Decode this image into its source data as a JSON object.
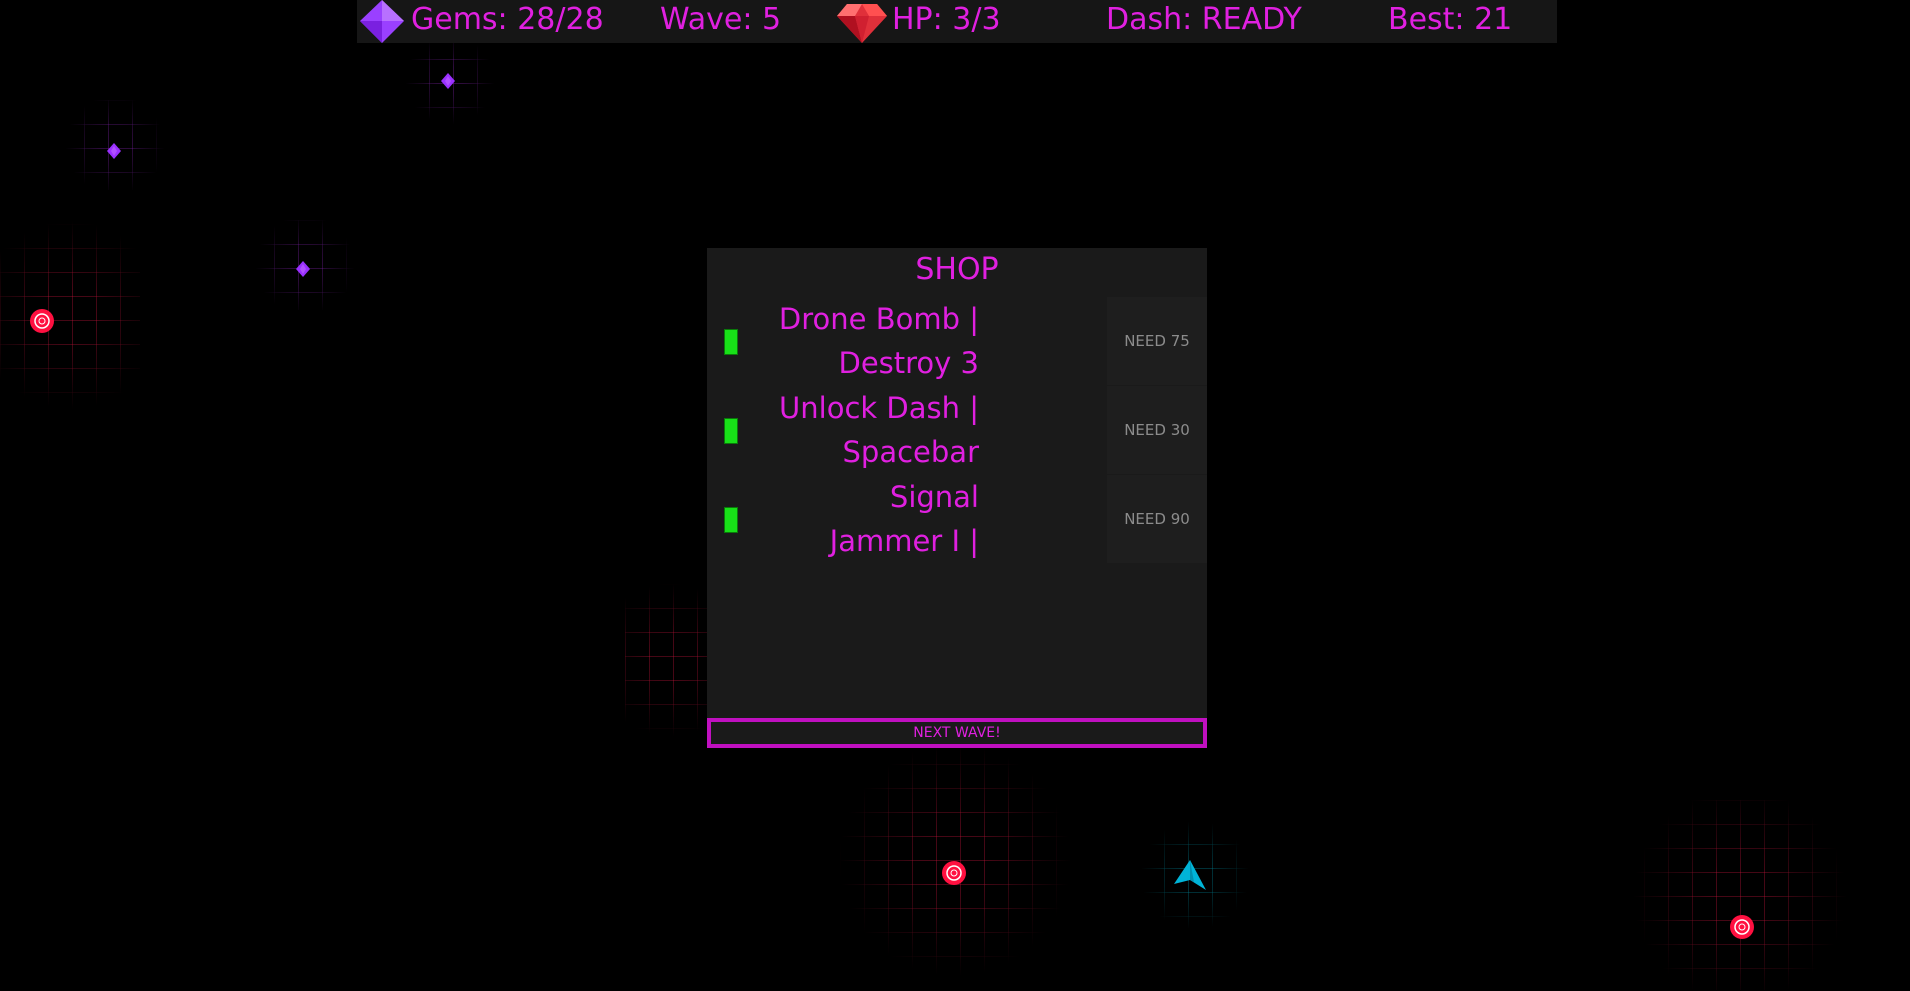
{
  "hud": {
    "gems": "Gems: 28/28",
    "wave": "Wave: 5",
    "hp": "HP: 3/3",
    "dash": "Dash: READY",
    "best": "Best: 21",
    "gem_icon": "purple-diamond-icon",
    "hp_icon": "red-gem-icon"
  },
  "shop": {
    "title": "SHOP",
    "items": [
      {
        "label": "Drone Bomb |\nDestroy 3",
        "cost": "NEED 75"
      },
      {
        "label": "Unlock Dash |\nSpacebar",
        "cost": "NEED 30"
      },
      {
        "label": "Signal\nJammer I |",
        "cost": "NEED 90"
      }
    ],
    "next_wave": "NEXT WAVE!"
  },
  "colors": {
    "accent": "#e020e0",
    "enemy": "#ff1040",
    "gem": "#9a30ff",
    "player": "#00b4d8",
    "owned_indicator": "#18e018"
  }
}
